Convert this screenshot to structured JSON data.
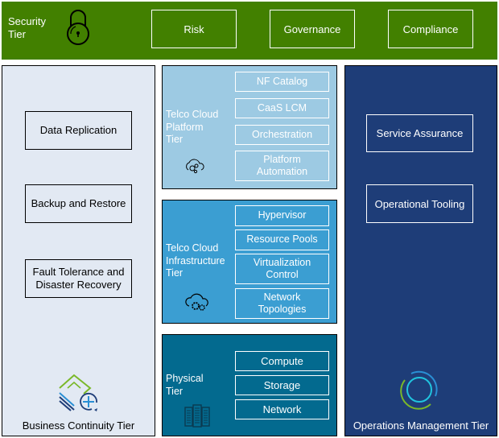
{
  "security_tier": {
    "label_line1": "Security",
    "label_line2": "Tier",
    "icon": "padlock-icon",
    "color": "#428000",
    "boxes": [
      "Risk",
      "Governance",
      "Compliance"
    ]
  },
  "business_continuity_tier": {
    "title": "Business Continuity Tier",
    "icon": "stacked-layers-plus-icon",
    "color": "#e2e9f3",
    "boxes": [
      {
        "line1": "Data Replication",
        "line2": ""
      },
      {
        "line1": "Backup and Restore",
        "line2": ""
      },
      {
        "line1": "Fault Tolerance and",
        "line2": "Disaster Recovery"
      }
    ]
  },
  "platform_tier": {
    "label_lines": [
      "Telco Cloud",
      "Platform",
      "Tier"
    ],
    "icon": "cloud-gears-icon",
    "color": "#9dcae3",
    "boxes": [
      {
        "line1": "NF Catalog",
        "line2": ""
      },
      {
        "line1": "CaaS LCM",
        "line2": ""
      },
      {
        "line1": "Orchestration",
        "line2": ""
      },
      {
        "line1": "Platform",
        "line2": "Automation"
      }
    ]
  },
  "infrastructure_tier": {
    "label_lines": [
      "Telco Cloud",
      "Infrastructure",
      "Tier"
    ],
    "icon": "cloud-gears-icon",
    "color": "#3b9ed2",
    "boxes": [
      {
        "line1": "Hypervisor",
        "line2": ""
      },
      {
        "line1": "Resource Pools",
        "line2": ""
      },
      {
        "line1": "Virtualization",
        "line2": "Control"
      },
      {
        "line1": "Network",
        "line2": "Topologies"
      }
    ]
  },
  "physical_tier": {
    "label_lines": [
      "Physical",
      "Tier"
    ],
    "icon": "server-rack-icon",
    "color": "#036a8f",
    "boxes": [
      "Compute",
      "Storage",
      "Network"
    ]
  },
  "operations_management_tier": {
    "title": "Operations Management Tier",
    "icon": "concentric-rings-icon",
    "color": "#1e3d78",
    "boxes": [
      "Service Assurance",
      "Operational Tooling"
    ]
  }
}
